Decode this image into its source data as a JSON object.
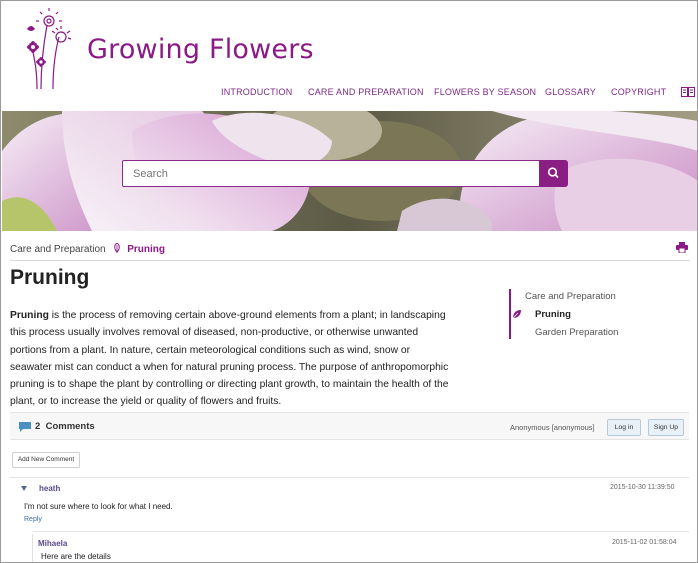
{
  "site": {
    "title": "Growing Flowers",
    "nav": [
      "INTRODUCTION",
      "CARE AND PREPARATION",
      "FLOWERS BY SEASON",
      "GLOSSARY",
      "COPYRIGHT"
    ],
    "brand_color": "#8b1a86"
  },
  "search": {
    "placeholder": "Search",
    "button_icon": "search-icon"
  },
  "breadcrumb": {
    "parent": "Care and Preparation",
    "current": "Pruning"
  },
  "page": {
    "title": "Pruning",
    "lead_term": "Pruning",
    "body": " is the process of removing certain above-ground elements from a plant; in landscaping this process usually involves removal of diseased, non-productive, or otherwise unwanted portions from a plant. In nature, certain meteorological conditions such as wind, snow or seawater mist can conduct a when for natural pruning process. The purpose of anthropomorphic pruning is to shape the plant by controlling or directing plant growth, to maintain the health of the plant, or to increase the yield or quality of flowers and fruits."
  },
  "toc": {
    "parent": "Care and Preparation",
    "active": "Pruning",
    "next": "Garden Preparation"
  },
  "comments": {
    "count": "2",
    "label": "Comments",
    "user": "Anonymous [anonymous]",
    "login_label": "Log in",
    "signup_label": "Sign Up",
    "add_label": "Add New Comment",
    "items": [
      {
        "author": "heath",
        "date": "2015-10-30 11:39:50",
        "text": "I'm not sure where to look for what I need.",
        "reply": "Reply"
      },
      {
        "author": "Mihaela",
        "date": "2015-11-02 01:58:04",
        "text": "Here are the details"
      }
    ]
  }
}
